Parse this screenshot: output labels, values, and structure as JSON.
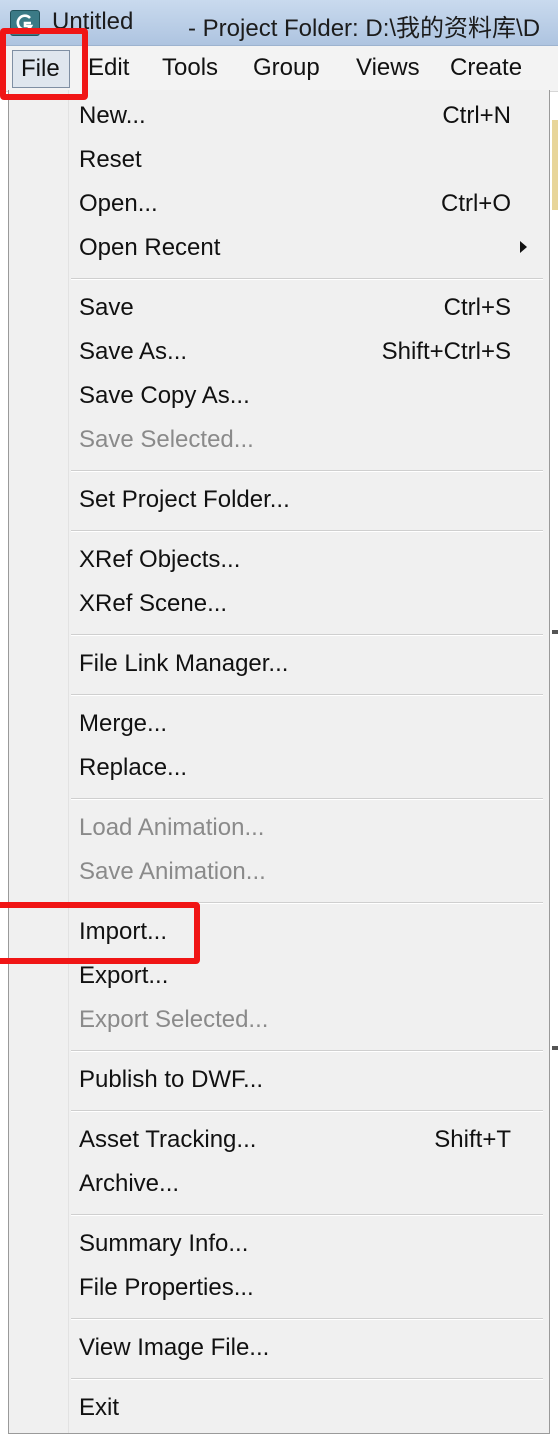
{
  "window": {
    "title": "Untitled",
    "project_path": "- Project Folder: D:\\我的资料库\\D"
  },
  "menubar": {
    "items": [
      {
        "label": "File"
      },
      {
        "label": "Edit"
      },
      {
        "label": "Tools"
      },
      {
        "label": "Group"
      },
      {
        "label": "Views"
      },
      {
        "label": "Create"
      }
    ]
  },
  "file_menu": {
    "items": [
      {
        "label": "New...",
        "shortcut": "Ctrl+N"
      },
      {
        "label": "Reset"
      },
      {
        "label": "Open...",
        "shortcut": "Ctrl+O"
      },
      {
        "label": "Open Recent"
      },
      {
        "label": "Save",
        "shortcut": "Ctrl+S"
      },
      {
        "label": "Save As...",
        "shortcut": "Shift+Ctrl+S"
      },
      {
        "label": "Save Copy As..."
      },
      {
        "label": "Save Selected..."
      },
      {
        "label": "Set Project Folder..."
      },
      {
        "label": "XRef Objects..."
      },
      {
        "label": "XRef Scene..."
      },
      {
        "label": "File Link Manager..."
      },
      {
        "label": "Merge..."
      },
      {
        "label": "Replace..."
      },
      {
        "label": "Load Animation..."
      },
      {
        "label": "Save Animation..."
      },
      {
        "label": "Import..."
      },
      {
        "label": "Export..."
      },
      {
        "label": "Export Selected..."
      },
      {
        "label": "Publish to DWF..."
      },
      {
        "label": "Asset Tracking...",
        "shortcut": "Shift+T"
      },
      {
        "label": "Archive..."
      },
      {
        "label": "Summary Info..."
      },
      {
        "label": "File Properties..."
      },
      {
        "label": "View Image File..."
      },
      {
        "label": "Exit"
      }
    ]
  },
  "icons": {
    "app": "3ds-max-app-icon",
    "submenu": "submenu-arrow-icon"
  },
  "colors": {
    "highlight": "#f01515",
    "disabled_text": "#8a8a8a"
  }
}
